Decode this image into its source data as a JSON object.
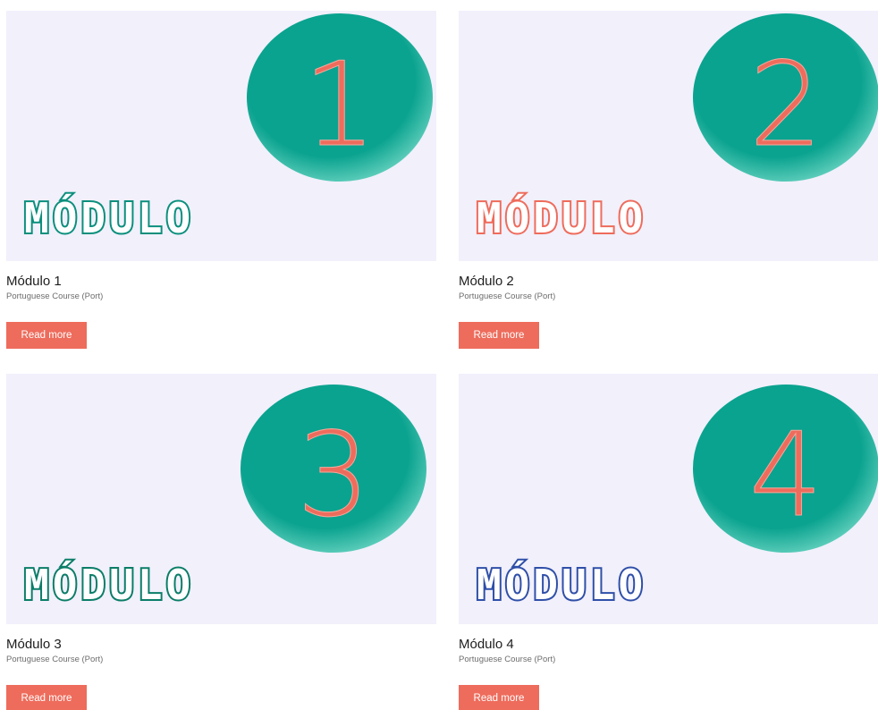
{
  "colors": {
    "circle": "#0aa38f",
    "digit": "#ee6c5c",
    "button": "#ee6c5c",
    "thumb_bg": "#f1f0fb"
  },
  "cards": [
    {
      "title": "Módulo 1",
      "subtitle": "Portuguese Course (Port)",
      "button": "Read more",
      "badge_number": "1",
      "banner_text": "MÓDULO",
      "banner_color": "#0b8f7d"
    },
    {
      "title": "Módulo 2",
      "subtitle": "Portuguese Course (Port)",
      "button": "Read more",
      "badge_number": "2",
      "banner_text": "MÓDULO",
      "banner_color": "#ee6c5c"
    },
    {
      "title": "Módulo 3",
      "subtitle": "Portuguese Course (Port)",
      "button": "Read more",
      "badge_number": "3",
      "banner_text": "MÓDULO",
      "banner_color": "#0b7d68"
    },
    {
      "title": "Módulo 4",
      "subtitle": "Portuguese Course (Port)",
      "button": "Read more",
      "badge_number": "4",
      "banner_text": "MÓDULO",
      "banner_color": "#2f4fa8"
    }
  ]
}
